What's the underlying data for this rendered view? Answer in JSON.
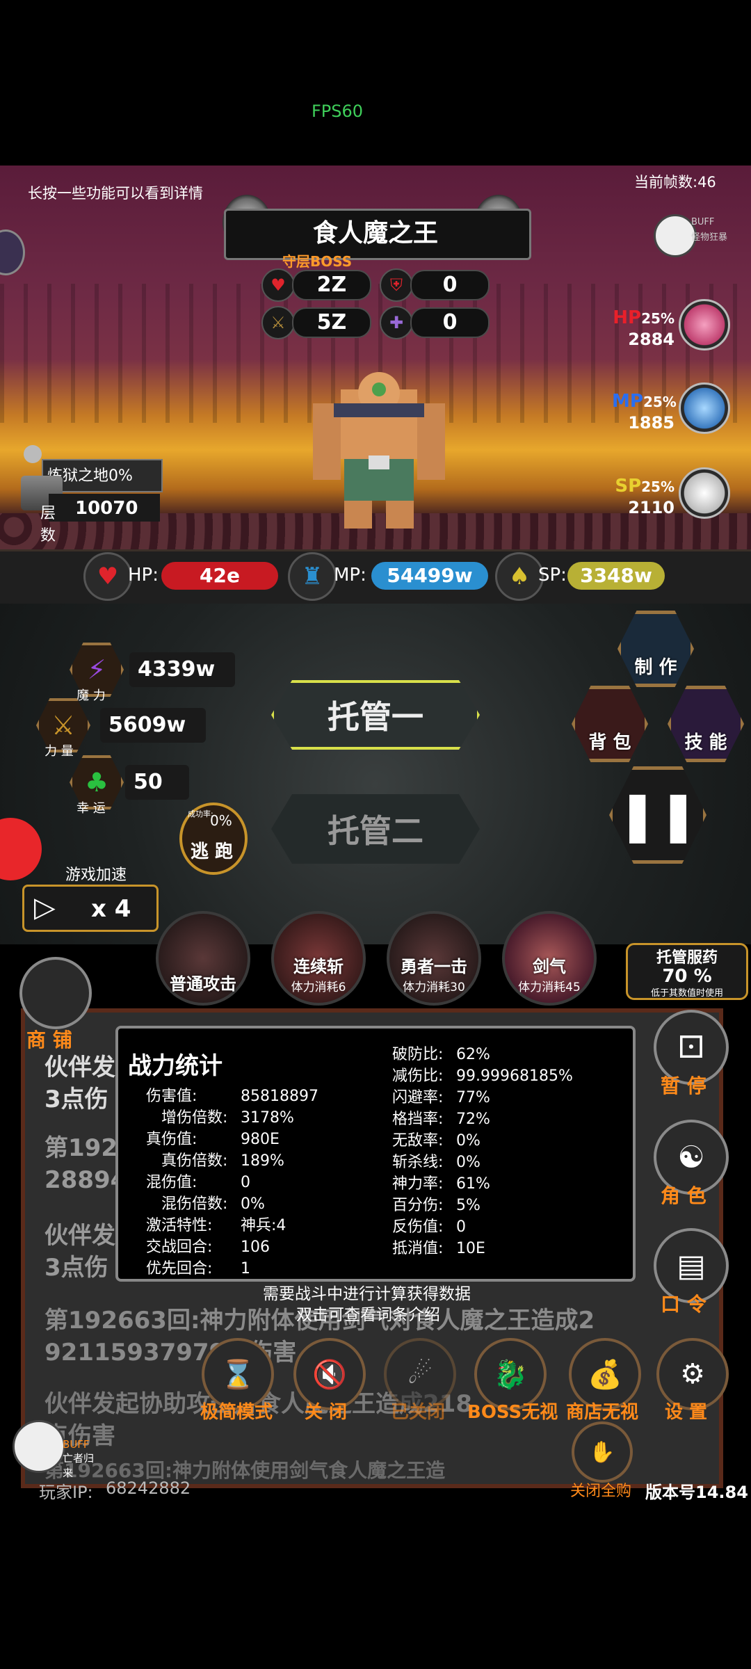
{
  "fps": "FPS60",
  "hint": "长按一些功能可以看到详情",
  "frame_count": "当前帧数:46",
  "boss": {
    "name": "食人魔之王",
    "tag": "守层BOSS",
    "hp": "2Z",
    "def": "0",
    "atk": "5Z",
    "mdef": "0"
  },
  "buff_top": {
    "label": "BUFF",
    "name": "怪物狂暴"
  },
  "potions": {
    "hp": {
      "label": "HP",
      "pct": "25%",
      "value": "2884"
    },
    "mp": {
      "label": "MP",
      "pct": "25%",
      "value": "1885"
    },
    "sp": {
      "label": "SP",
      "pct": "25%",
      "value": "2110"
    }
  },
  "floor": {
    "name": "炼狱之地0%",
    "label": "层数",
    "value": "10070"
  },
  "resources": {
    "hp_label": "HP:",
    "hp_value": "42e",
    "mp_label": "MP:",
    "mp_value": "54499w",
    "sp_label": "SP:",
    "sp_value": "3348w"
  },
  "attrs": {
    "magic": {
      "label": "魔 力",
      "value": "4339w"
    },
    "power": {
      "label": "力 量",
      "value": "5609w"
    },
    "luck": {
      "label": "幸 运",
      "value": "50"
    }
  },
  "escape": {
    "rate_label": "成功率:",
    "rate": "0%",
    "label": "逃 跑"
  },
  "speed": {
    "label": "游戏加速",
    "value": "x 4"
  },
  "auto": {
    "one": "托管一",
    "two": "托管二"
  },
  "actions": {
    "craft": "制 作",
    "bag": "背 包",
    "skill": "技 能"
  },
  "skills": [
    {
      "name": "普通攻击",
      "cost": ""
    },
    {
      "name": "连续斩",
      "cost": "体力消耗6"
    },
    {
      "name": "勇者一击",
      "cost": "体力消耗30"
    },
    {
      "name": "剑气",
      "cost": "体力消耗45"
    }
  ],
  "auto_potion": {
    "title": "托管服药",
    "pct": "70 %",
    "note": "低于其数值时使用"
  },
  "shop": "商 铺",
  "log": [
    "伙伴发",
    "3点伤",
    "第192",
    "28894",
    "伙伴发",
    "3点伤",
    "第192663回:神力附体使用剑气对食人魔之王造成2",
    "92115937979点伤害",
    "伙伴发起协助攻击对食人魔之王造成218",
    "点伤害",
    "第192663回:神力附体使用剑气食人魔之王造"
  ],
  "popup": {
    "title": "战力统计",
    "left": [
      {
        "k": "伤害值:",
        "v": "85818897",
        "indent": false
      },
      {
        "k": "增伤倍数:",
        "v": "3178%",
        "indent": true
      },
      {
        "k": "真伤值:",
        "v": "980E",
        "indent": false
      },
      {
        "k": "真伤倍数:",
        "v": "189%",
        "indent": true
      },
      {
        "k": "混伤值:",
        "v": "0",
        "indent": false
      },
      {
        "k": "混伤倍数:",
        "v": "0%",
        "indent": true
      },
      {
        "k": "激活特性:",
        "v": "神兵:4",
        "indent": false
      },
      {
        "k": "交战回合:",
        "v": "106",
        "indent": false
      },
      {
        "k": "优先回合:",
        "v": "1",
        "indent": false
      }
    ],
    "right": [
      {
        "k": "破防比:",
        "v": "62%"
      },
      {
        "k": "减伤比:",
        "v": "99.99968185%"
      },
      {
        "k": "闪避率:",
        "v": "77%"
      },
      {
        "k": "格挡率:",
        "v": "72%"
      },
      {
        "k": "无敌率:",
        "v": "0%"
      },
      {
        "k": "斩杀线:",
        "v": "0%"
      },
      {
        "k": "神力率:",
        "v": "61%"
      },
      {
        "k": "百分伤:",
        "v": "5%"
      },
      {
        "k": "反伤值:",
        "v": "0"
      },
      {
        "k": "抵消值:",
        "v": "10E"
      }
    ],
    "note1": "需要战斗中进行计算获得数据",
    "note2": "双击可查看词条介绍"
  },
  "right_buttons": [
    "暂 停",
    "角 色",
    "口 令"
  ],
  "toolbar": [
    "极简模式",
    "关 闭",
    "已关闭",
    "BOSS无视",
    "商店无视",
    "设 置"
  ],
  "close_all_buy": "关闭全购",
  "buff_bottom": {
    "label": "BUFF",
    "name": "亡者归来"
  },
  "player_ip_label": "玩家IP:",
  "player_ip": "68242882",
  "version": "版本号14.84",
  "colors": {
    "hp": "#c81a22",
    "mp": "#2a8fd0",
    "sp": "#b8b035",
    "accent": "#ff8a1a"
  }
}
